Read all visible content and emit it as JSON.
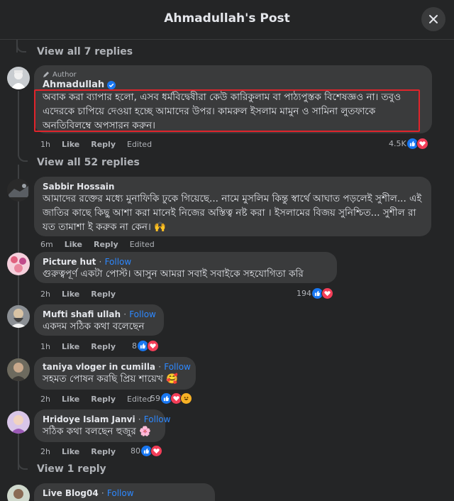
{
  "header": {
    "title": "Ahmadullah's Post"
  },
  "top": {
    "view_replies": "View all 7 replies"
  },
  "author_comment": {
    "badge": "Author",
    "name": "Ahmadullah",
    "text": "অবাক করা ব্যাপার হলো, এসব ধর্মবিদ্বেষীরা কেউ কারিকুলাম বা পাঠ্যপুস্তক বিশেষজ্ঞও না। তবুও এদেরকে চাপিয়ে দেওয়া হচ্ছে আমাদের উপর। কামরুল ইসলাম মামুন ও সামিনা লুতফাকে অনতিবিলম্বে অপসারন করুন।",
    "time": "1h",
    "like": "Like",
    "reply": "Reply",
    "edited": "Edited",
    "reactions": "4.5K",
    "view_replies": "View all 52 replies"
  },
  "comments": [
    {
      "name": "Sabbir Hossain",
      "follow": "",
      "text": "আমাদের রক্তের মধ্যে মুনাফিকি ঢুকে গিয়েছে... নামে মুসলিম কিন্তু স্বার্থে আঘাত পড়লেই সুশীল... এই জাতির কাছে কিছু আশা করা মানেই নিজের অস্তিত্ব নষ্ট করা । ইসলামের বিজয় সুনিশ্চিত... সুশীল রা যত তামাশা ই করুক না কেন। 🙌",
      "time": "6m",
      "edited": "Edited",
      "reactions": ""
    },
    {
      "name": "Picture hut",
      "follow": "Follow",
      "text": "গুরুত্বপূর্ণ একটা পোস্ট। আসুন আমরা সবাই সবাইকে সহযোগিতা করি",
      "time": "2h",
      "edited": "",
      "reactions": "194"
    },
    {
      "name": "Mufti shafi ullah",
      "follow": "Follow",
      "text": "একদম সঠিক কথা বলেছেন",
      "time": "1h",
      "edited": "",
      "reactions": "8"
    },
    {
      "name": "taniya vloger in cumilla",
      "follow": "Follow",
      "text": "সহমত পোষন করছি প্রিয় শায়েখ 🥰",
      "time": "2h",
      "edited": "Edited",
      "reactions": "59"
    },
    {
      "name": "Hridoye Islam Janvi",
      "follow": "Follow",
      "text": "সঠিক কথা বলছেন হুজুর 🌸",
      "time": "2h",
      "edited": "",
      "reactions": "80"
    },
    {
      "name": "Live Blog04",
      "follow": "Follow",
      "text": "",
      "time": "",
      "edited": "",
      "reactions": ""
    }
  ],
  "labels": {
    "like": "Like",
    "reply": "Reply",
    "dot": "·"
  },
  "bottom": {
    "view_replies": "View 1 reply"
  },
  "colors": {
    "background": "#242526",
    "bubble": "#3a3b3c",
    "link": "#2d88ff",
    "highlight": "#e0242b",
    "like": "#1877f2",
    "love": "#f33e58"
  }
}
